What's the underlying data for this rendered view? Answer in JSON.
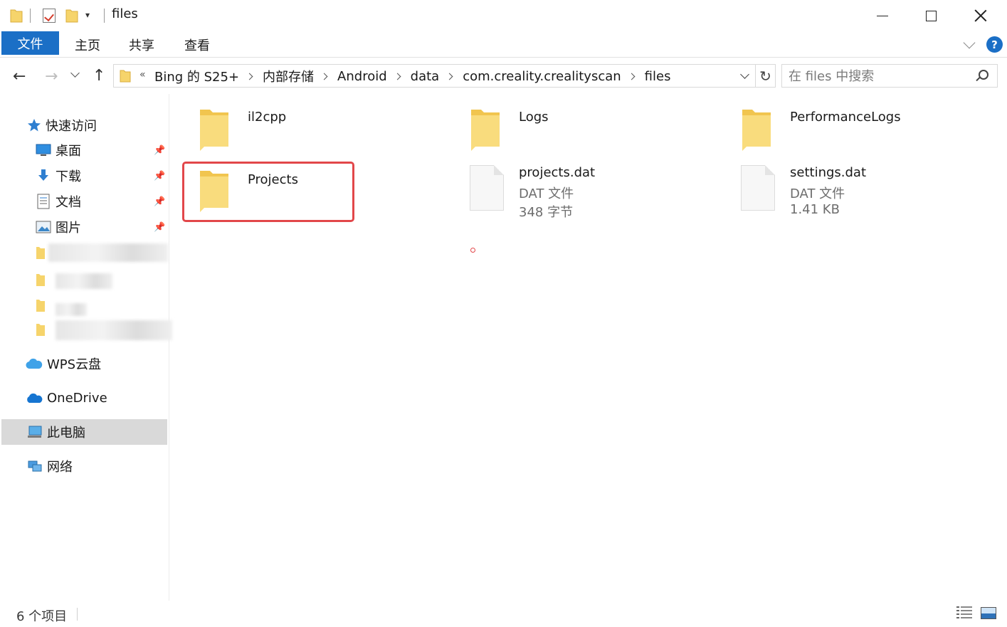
{
  "window": {
    "title": "files",
    "quick_access_dropdown": "▾"
  },
  "ribbon": {
    "tabs": [
      {
        "label": "文件",
        "active": true
      },
      {
        "label": "主页"
      },
      {
        "label": "共享"
      },
      {
        "label": "查看"
      }
    ],
    "help_label": "?"
  },
  "navigation": {
    "back_icon": "←",
    "forward_icon": "→",
    "up_icon": "↑",
    "refresh_icon": "↻",
    "overflow": "«",
    "breadcrumbs": [
      "Bing 的 S25+",
      "内部存储",
      "Android",
      "data",
      "com.creality.crealityscan",
      "files"
    ]
  },
  "search": {
    "placeholder": "在 files 中搜索"
  },
  "sidebar": {
    "quick_access": {
      "label": "快速访问",
      "icon": "star-icon"
    },
    "pinned": [
      {
        "label": "桌面",
        "icon": "desktop-icon"
      },
      {
        "label": "下载",
        "icon": "download-icon"
      },
      {
        "label": "文档",
        "icon": "document-icon"
      },
      {
        "label": "图片",
        "icon": "pictures-icon"
      }
    ],
    "pin_glyph": "📌",
    "wps": {
      "label": "WPS云盘",
      "icon": "cloud-icon"
    },
    "onedrive": {
      "label": "OneDrive",
      "icon": "onedrive-icon"
    },
    "this_pc": {
      "label": "此电脑",
      "icon": "computer-icon",
      "selected": true
    },
    "network": {
      "label": "网络",
      "icon": "network-icon"
    }
  },
  "files": [
    {
      "name": "il2cpp",
      "type": "folder"
    },
    {
      "name": "Logs",
      "type": "folder"
    },
    {
      "name": "PerformanceLogs",
      "type": "folder"
    },
    {
      "name": "Projects",
      "type": "folder",
      "highlighted": true
    },
    {
      "name": "projects.dat",
      "type": "file",
      "kind": "DAT 文件",
      "size": "348 字节"
    },
    {
      "name": "settings.dat",
      "type": "file",
      "kind": "DAT 文件",
      "size": "1.41 KB"
    }
  ],
  "status": {
    "item_count": "6 个项目"
  },
  "colors": {
    "accent": "#1b6fc6",
    "highlight": "#e2474a",
    "folder": "#f6d46b",
    "selected_bg": "#d9d9d9"
  }
}
